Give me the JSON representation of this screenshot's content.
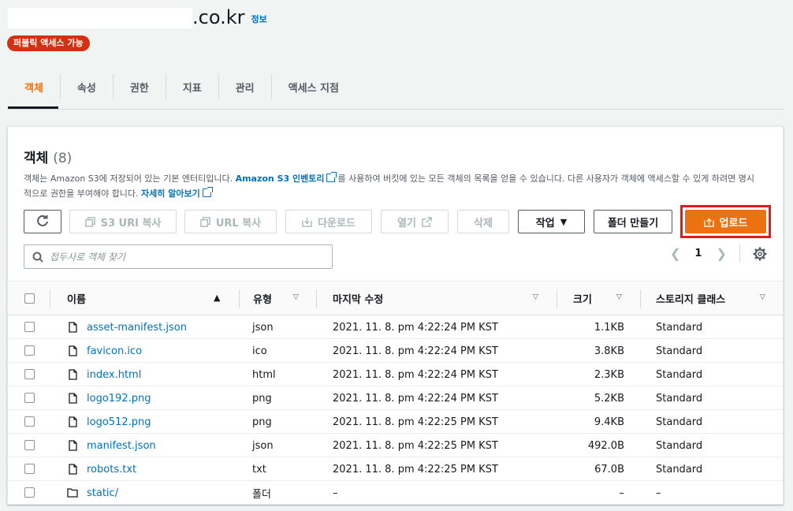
{
  "bucket": {
    "domain_suffix": ".co.kr",
    "info_label": "정보",
    "access_badge": "퍼블릭 액세스 가능"
  },
  "tabs": [
    {
      "label": "객체",
      "active": true
    },
    {
      "label": "속성"
    },
    {
      "label": "권한"
    },
    {
      "label": "지표"
    },
    {
      "label": "관리"
    },
    {
      "label": "액세스 지점"
    }
  ],
  "objects_panel": {
    "title": "객체",
    "count": "(8)",
    "desc_part1": "객체는 Amazon S3에 저장되어 있는 기본 엔터티입니다. ",
    "desc_link1": "Amazon S3 인벤토리",
    "desc_part2": "를 사용하여 버킷에 있는 모든 객체의 목록을 얻을 수 있습니다. 다른 사용자가 객체에 액세스할 수 있게 하려면 명시적으로 권한을 부여해야 합니다. ",
    "desc_link2": "자세히 알아보기",
    "search_placeholder": "접두사로 객체 찾기"
  },
  "toolbar": {
    "copy_s3_uri": "S3 URI 복사",
    "copy_url": "URL 복사",
    "download": "다운로드",
    "open": "열기",
    "delete": "삭제",
    "actions": "작업",
    "create_folder": "폴더 만들기",
    "upload": "업로드"
  },
  "pagination": {
    "page": "1"
  },
  "table": {
    "columns": {
      "name": "이름",
      "type": "유형",
      "modified": "마지막 수정",
      "size": "크기",
      "storage_class": "스토리지 클래스"
    },
    "rows": [
      {
        "name": "asset-manifest.json",
        "type": "json",
        "modified": "2021. 11. 8. pm 4:22:24 PM KST",
        "size": "1.1KB",
        "storage": "Standard"
      },
      {
        "name": "favicon.ico",
        "type": "ico",
        "modified": "2021. 11. 8. pm 4:22:24 PM KST",
        "size": "3.8KB",
        "storage": "Standard"
      },
      {
        "name": "index.html",
        "type": "html",
        "modified": "2021. 11. 8. pm 4:22:24 PM KST",
        "size": "2.3KB",
        "storage": "Standard"
      },
      {
        "name": "logo192.png",
        "type": "png",
        "modified": "2021. 11. 8. pm 4:22:24 PM KST",
        "size": "5.2KB",
        "storage": "Standard"
      },
      {
        "name": "logo512.png",
        "type": "png",
        "modified": "2021. 11. 8. pm 4:22:25 PM KST",
        "size": "9.4KB",
        "storage": "Standard"
      },
      {
        "name": "manifest.json",
        "type": "json",
        "modified": "2021. 11. 8. pm 4:22:25 PM KST",
        "size": "492.0B",
        "storage": "Standard"
      },
      {
        "name": "robots.txt",
        "type": "txt",
        "modified": "2021. 11. 8. pm 4:22:25 PM KST",
        "size": "67.0B",
        "storage": "Standard"
      },
      {
        "name": "static/",
        "type": "폴더",
        "modified": "–",
        "size": "–",
        "storage": "–"
      }
    ]
  },
  "colors": {
    "accent": "#ec7211",
    "link": "#0073bb",
    "badge": "#d13212",
    "highlight": "#e4191c"
  }
}
